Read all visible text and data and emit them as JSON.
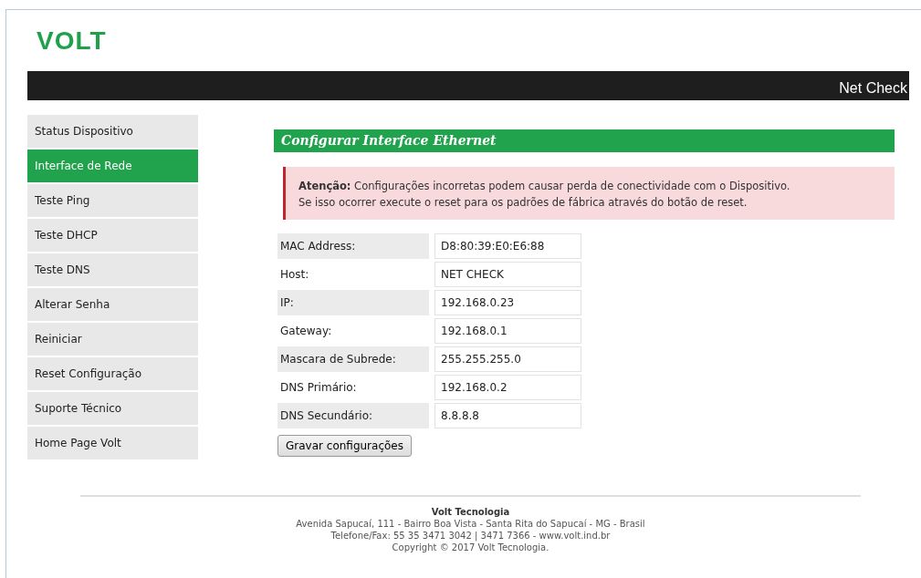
{
  "logo": "VOLT",
  "header_bar": {
    "title": "Net Check"
  },
  "sidebar": {
    "items": [
      {
        "label": "Status Dispositivo",
        "selected": false
      },
      {
        "label": "Interface de Rede",
        "selected": true
      },
      {
        "label": "Teste Ping",
        "selected": false
      },
      {
        "label": "Teste DHCP",
        "selected": false
      },
      {
        "label": "Teste DNS",
        "selected": false
      },
      {
        "label": "Alterar Senha",
        "selected": false
      },
      {
        "label": "Reiniciar",
        "selected": false
      },
      {
        "label": "Reset Configuração",
        "selected": false
      },
      {
        "label": "Suporte Técnico",
        "selected": false
      },
      {
        "label": "Home Page Volt",
        "selected": false
      }
    ]
  },
  "section_title": "Configurar Interface Ethernet",
  "alert": {
    "lines": [
      "**Atenção:** Configurações incorretas podem causar perda de conectividade com o Dispositivo.",
      "Se isso ocorrer execute o reset para os padrões de fábrica através do botão de reset."
    ]
  },
  "form": {
    "fields": [
      {
        "label": "MAC Address:",
        "value": "D8:80:39:E0:E6:88"
      },
      {
        "label": "Host:",
        "value": "NET CHECK"
      },
      {
        "label": "IP:",
        "value": "192.168.0.23"
      },
      {
        "label": "Gateway:",
        "value": "192.168.0.1"
      },
      {
        "label": "Mascara de Subrede:",
        "value": "255.255.255.0"
      },
      {
        "label": "DNS Primário:",
        "value": "192.168.0.2"
      },
      {
        "label": "DNS Secundário:",
        "value": "8.8.8.8"
      }
    ],
    "submit": "Gravar configurações"
  },
  "footer": {
    "company": "Volt Tecnologia",
    "lines": [
      "Avenida Sapucaí, 111 - Bairro Boa Vista - Santa Rita do Sapucaí - MG - Brasil",
      "Telefone/Fax: 55 35 3471 3042 | 3471 7366 - www.volt.ind.br",
      "Copyright © 2017 Volt Tecnologia."
    ]
  }
}
